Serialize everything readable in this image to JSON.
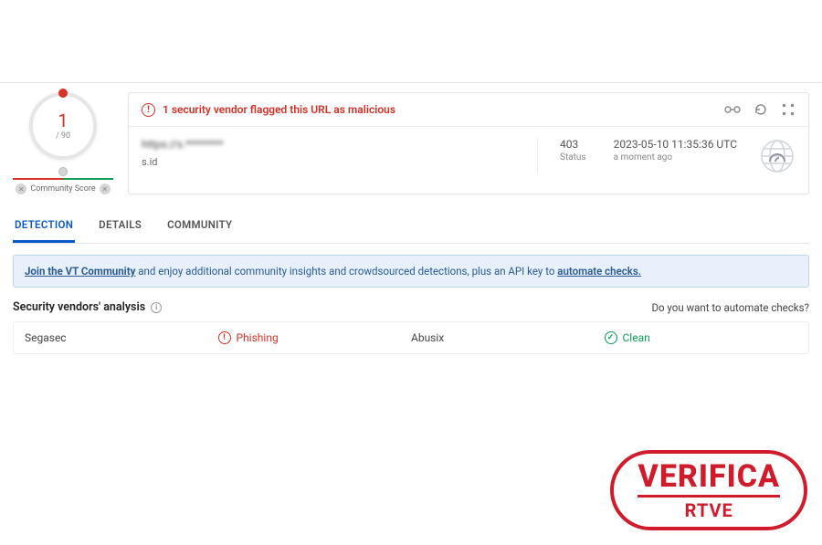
{
  "score": {
    "value": "1",
    "denom": "/ 90",
    "community_label": "Community Score"
  },
  "alert": {
    "text": "1 security vendor flagged this URL as malicious"
  },
  "url": {
    "full": "https://s.********",
    "domain": "s.id"
  },
  "status": {
    "code": "403",
    "label": "Status"
  },
  "time": {
    "value": "2023-05-10 11:35:36 UTC",
    "relative": "a moment ago"
  },
  "tabs": {
    "detection": "DETECTION",
    "details": "DETAILS",
    "community": "COMMUNITY"
  },
  "banner": {
    "link1": "Join the VT Community",
    "mid": " and enjoy additional community insights and crowdsourced detections, plus an API key to ",
    "link2": "automate checks."
  },
  "analysis": {
    "title": "Security vendors' analysis",
    "automate": "Do you want to automate checks?"
  },
  "vendors": [
    {
      "name": "Segasec",
      "verdict": "Phishing",
      "type": "phishing"
    },
    {
      "name": "Abusix",
      "verdict": "Clean",
      "type": "clean"
    }
  ],
  "stamp": {
    "line1": "VERIFICA",
    "line2": "RTVE"
  }
}
